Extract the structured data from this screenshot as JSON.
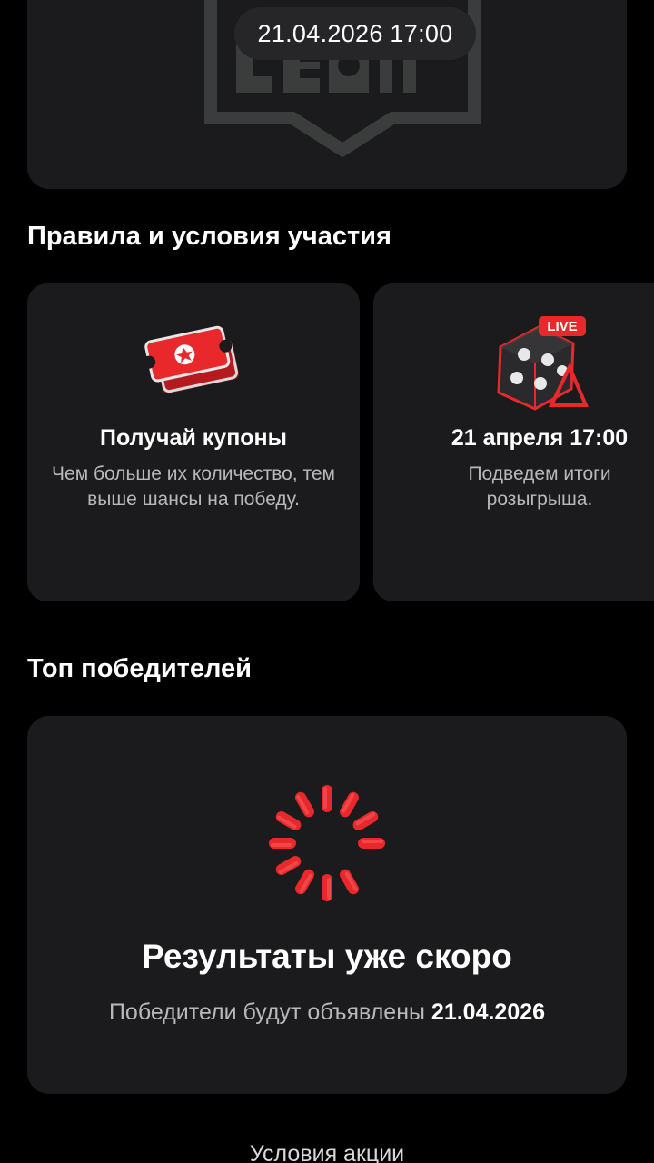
{
  "banner": {
    "date_time": "21.04.2026 17:00",
    "logo_icon": "leon-logo-icon"
  },
  "rules": {
    "title": "Правила и условия участия",
    "cards": [
      {
        "icon": "ticket-coupons-icon",
        "heading": "Получай купоны",
        "text": "Чем больше их количество, тем выше шансы на победу."
      },
      {
        "icon": "live-lottery-drum-icon",
        "badge": "LIVE",
        "heading": "21 апреля 17:00",
        "text": "Подведем итоги розыгрыша."
      }
    ]
  },
  "winners": {
    "title": "Топ победителей",
    "spinner_icon": "loading-spinner-icon",
    "results_title": "Результаты уже скоро",
    "results_sub_prefix": "Победители будут объявлены",
    "results_sub_date": "21.04.2026"
  },
  "footer": {
    "terms_link": "Условия акции"
  },
  "colors": {
    "background": "#000000",
    "card": "#1b1b1d",
    "accent_red": "#e8282b",
    "muted_text": "#b8b8bc"
  }
}
